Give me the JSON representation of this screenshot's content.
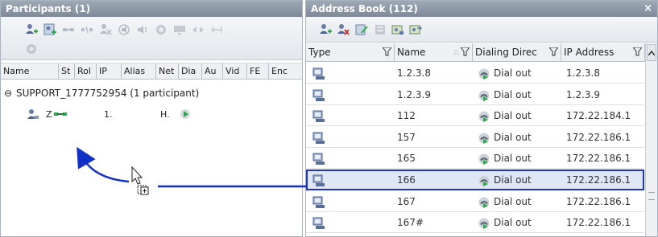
{
  "colors": {
    "title_bar": "#8894a2",
    "selection_border": "#1f33b8",
    "selection_fill": "#dfe6f5",
    "drag_arrow": "#1030c8",
    "connect_icon_green": "#2ea84b"
  },
  "participants": {
    "title": "Participants (1)",
    "toolbar_icons": [
      "add-participant-icon",
      "add-from-address-book-icon",
      "connect-icon",
      "disconnect-icon",
      "delete-participant-icon",
      "mute-audio-icon",
      "block-audio-icon",
      "suspend-video-icon",
      "monitor-icon",
      "change-layout-icon",
      "move-participant-icon",
      "save-to-address-book-icon"
    ],
    "columns": [
      "Name",
      "St",
      "Rol",
      "IP",
      "Alias",
      "Net",
      "Dia",
      "Au",
      "Vid",
      "FE",
      "Enc"
    ],
    "conference": {
      "toggle": "⊖",
      "label": "SUPPORT_1777752954 (1 participant)"
    },
    "participant": {
      "name": "Z",
      "col_ip": "1.",
      "col_dial": "H."
    }
  },
  "address_book": {
    "title": "Address Book (112)",
    "close": "×",
    "toolbar_icons": [
      "new-participant-icon",
      "delete-participant-icon",
      "edit-participant-icon",
      "properties-icon",
      "import-icon",
      "export-icon"
    ],
    "columns": {
      "type": "Type",
      "name": "Name",
      "dialing": "Dialing Direc",
      "ip": "IP Address"
    },
    "sort": "ascending",
    "rows": [
      {
        "name": "1.2.3.8",
        "dialing": "Dial out",
        "ip": "1.2.3.8",
        "selected": false
      },
      {
        "name": "1.2.3.9",
        "dialing": "Dial out",
        "ip": "1.2.3.9",
        "selected": false
      },
      {
        "name": "112",
        "dialing": "Dial out",
        "ip": "172.22.184.1",
        "selected": false
      },
      {
        "name": "157",
        "dialing": "Dial out",
        "ip": "172.22.186.1",
        "selected": false
      },
      {
        "name": "165",
        "dialing": "Dial out",
        "ip": "172.22.186.1",
        "selected": false
      },
      {
        "name": "166",
        "dialing": "Dial out",
        "ip": "172.22.186.1",
        "selected": true
      },
      {
        "name": "167",
        "dialing": "Dial out",
        "ip": "172.22.186.1",
        "selected": false
      },
      {
        "name": "167#",
        "dialing": "Dial out",
        "ip": "172.22.186.1",
        "selected": false
      }
    ]
  }
}
